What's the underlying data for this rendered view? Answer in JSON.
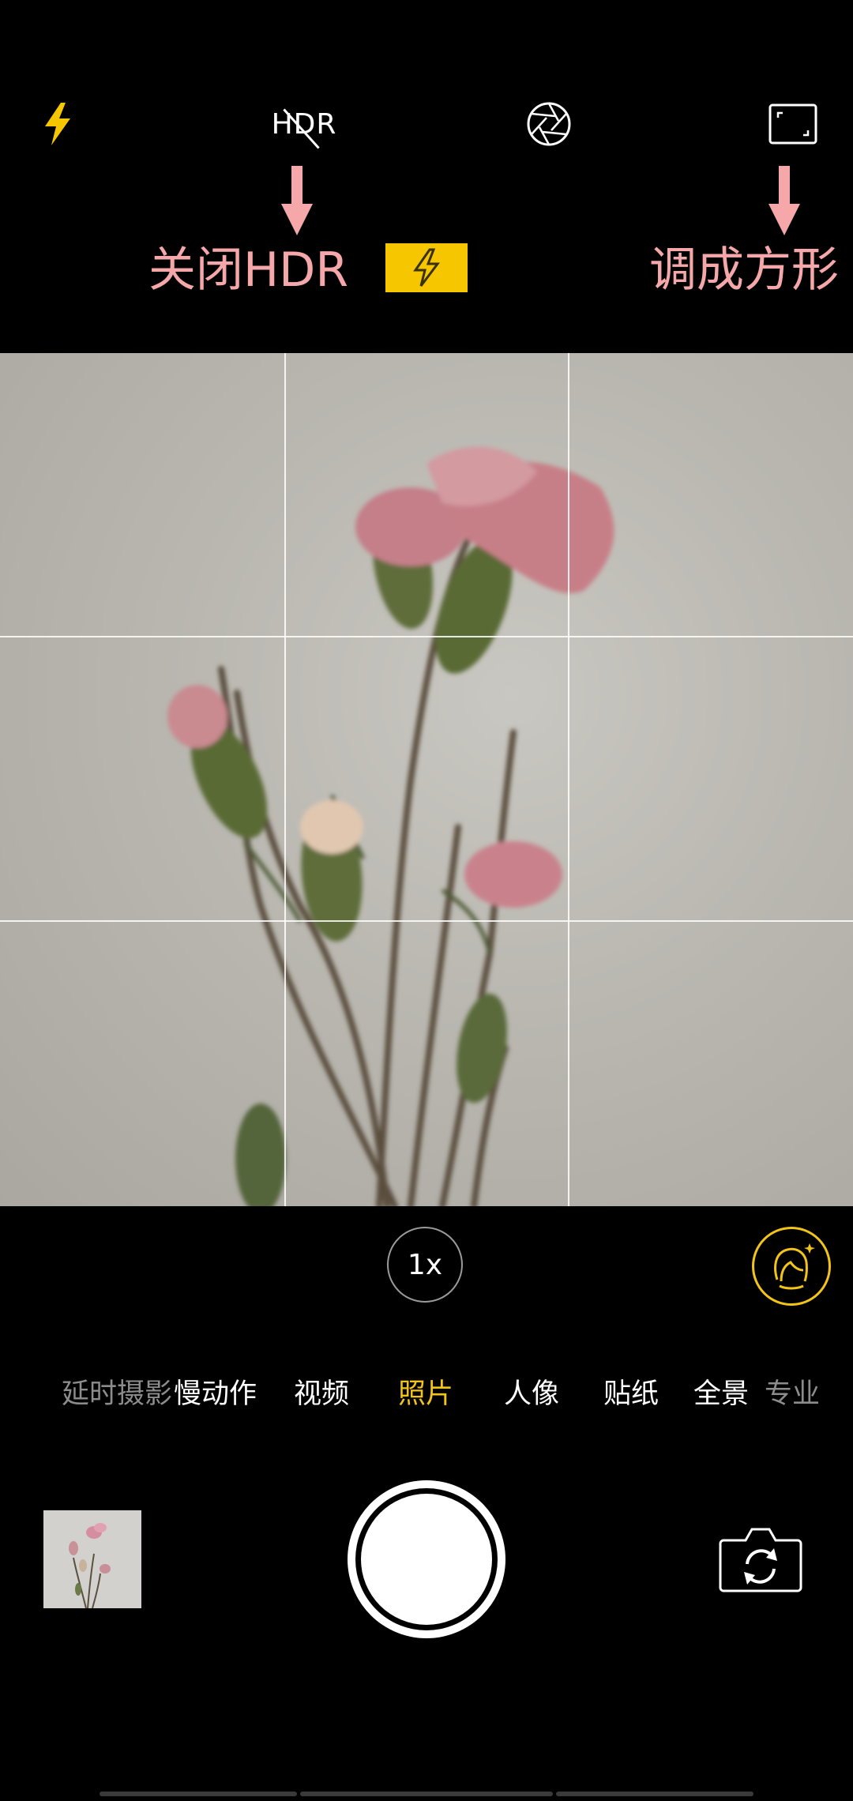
{
  "top_bar": {
    "flash_icon": "flash-icon",
    "hdr_label": "HDR",
    "hdr_state": "off",
    "aperture_icon": "aperture-icon",
    "ratio_icon": "aspect-ratio-icon"
  },
  "annotations": {
    "left_text": "关闭HDR",
    "right_text": "调成方形",
    "color": "#f6a7a9",
    "badge_color": "#f6c700"
  },
  "viewfinder": {
    "grid": "3x3"
  },
  "zoom": {
    "label": "1x"
  },
  "beauty": {
    "icon": "beauty-face-icon",
    "color": "#f2c418"
  },
  "modes": [
    {
      "label": "延时摄影",
      "state": "dim"
    },
    {
      "label": "慢动作",
      "state": "normal"
    },
    {
      "label": "视频",
      "state": "normal"
    },
    {
      "label": "照片",
      "state": "active"
    },
    {
      "label": "人像",
      "state": "normal"
    },
    {
      "label": "贴纸",
      "state": "normal"
    },
    {
      "label": "全景",
      "state": "normal"
    },
    {
      "label": "专业",
      "state": "dim"
    }
  ],
  "bottom": {
    "gallery_icon": "gallery-thumbnail",
    "shutter_icon": "shutter-button",
    "switch_icon": "switch-camera-icon"
  }
}
